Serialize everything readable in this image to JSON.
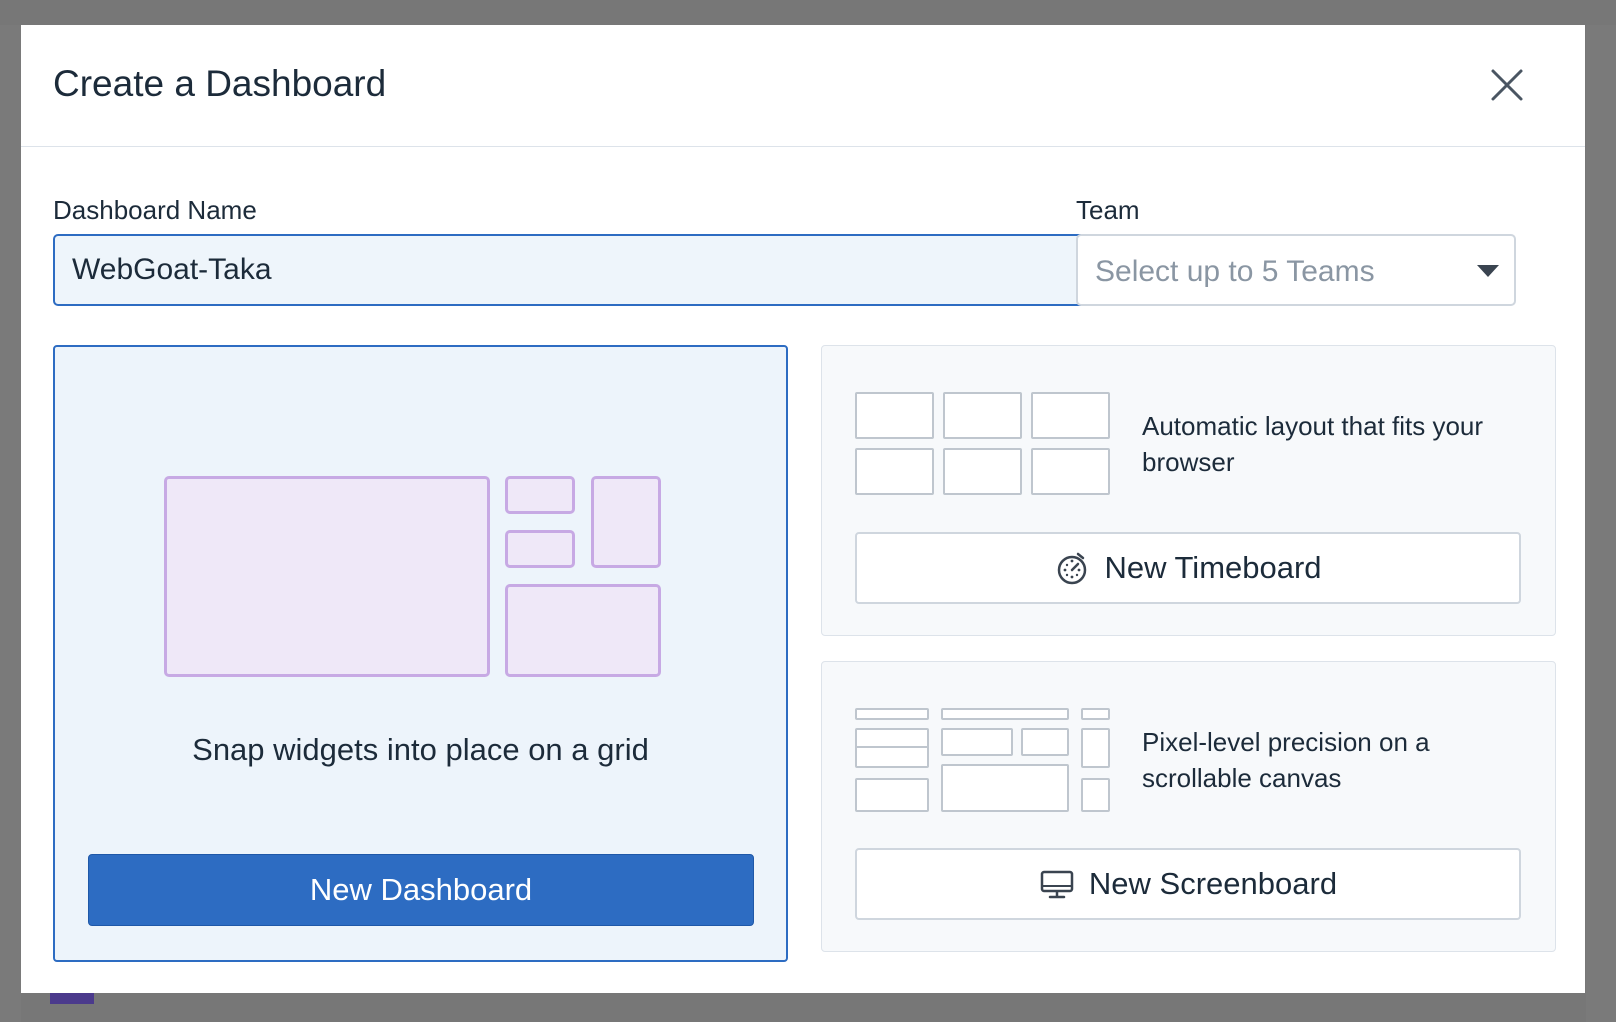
{
  "modal": {
    "title": "Create a Dashboard",
    "close_icon": "close-icon"
  },
  "form": {
    "name_label": "Dashboard Name",
    "name_value": "WebGoat-Taka",
    "team_label": "Team",
    "team_placeholder": "Select up to 5 Teams",
    "team_caret_icon": "caret-down-icon"
  },
  "dashboard_option": {
    "description": "Snap widgets into place on a grid",
    "button_label": "New Dashboard",
    "illustration": "grid-layout-illustration",
    "colors": {
      "accent": "#2d6cc2",
      "illustration_fill": "#efe8f8",
      "illustration_stroke": "#c7a9e4"
    }
  },
  "timeboard_option": {
    "description": "Automatic layout that fits your browser",
    "button_label": "New Timeboard",
    "button_icon": "stopwatch-icon",
    "illustration": "auto-layout-illustration"
  },
  "screenboard_option": {
    "description": "Pixel-level precision on a scrollable canvas",
    "button_label": "New Screenboard",
    "button_icon": "monitor-icon",
    "illustration": "free-layout-illustration"
  }
}
